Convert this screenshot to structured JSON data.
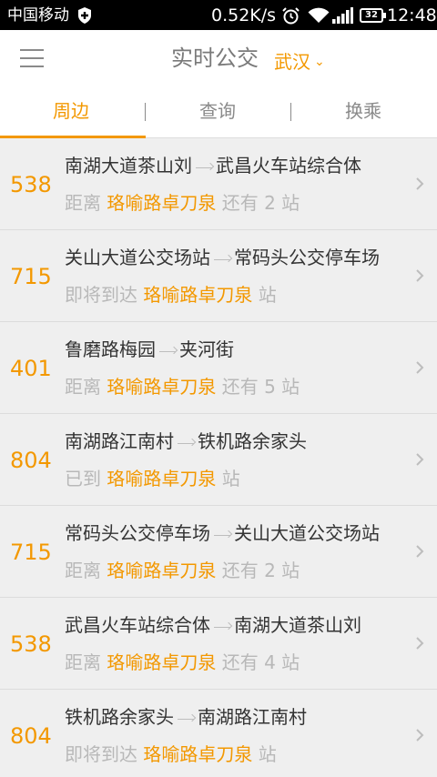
{
  "status_bar": {
    "carrier": "中国移动",
    "net_speed": "0.52K/s",
    "battery": "32",
    "time": "12:48"
  },
  "header": {
    "title": "实时公交",
    "city": "武汉"
  },
  "tabs": [
    {
      "label": "周边",
      "active": true
    },
    {
      "label": "查询",
      "active": false
    },
    {
      "label": "换乘",
      "active": false
    }
  ],
  "colors": {
    "accent": "#f39800",
    "text": "#333333",
    "muted": "#b8b8b8",
    "background": "#efefef"
  },
  "routes": [
    {
      "number": "538",
      "from": "南湖大道茶山刘",
      "to": "武昌火车站综合体",
      "prefix": "距离",
      "stop": "珞喻路卓刀泉",
      "middle": "还有",
      "count": "2",
      "suffix": "站"
    },
    {
      "number": "715",
      "from": "关山大道公交场站",
      "to": "常码头公交停车场",
      "prefix": "即将到达",
      "stop": "珞喻路卓刀泉",
      "middle": "",
      "count": "",
      "suffix": "站"
    },
    {
      "number": "401",
      "from": "鲁磨路梅园",
      "to": "夹河街",
      "prefix": "距离",
      "stop": "珞喻路卓刀泉",
      "middle": "还有",
      "count": "5",
      "suffix": "站"
    },
    {
      "number": "804",
      "from": "南湖路江南村",
      "to": "铁机路余家头",
      "prefix": "已到",
      "stop": "珞喻路卓刀泉",
      "middle": "",
      "count": "",
      "suffix": "站"
    },
    {
      "number": "715",
      "from": "常码头公交停车场",
      "to": "关山大道公交场站",
      "prefix": "距离",
      "stop": "珞喻路卓刀泉",
      "middle": "还有",
      "count": "2",
      "suffix": "站"
    },
    {
      "number": "538",
      "from": "武昌火车站综合体",
      "to": "南湖大道茶山刘",
      "prefix": "距离",
      "stop": "珞喻路卓刀泉",
      "middle": "还有",
      "count": "4",
      "suffix": "站"
    },
    {
      "number": "804",
      "from": "铁机路余家头",
      "to": "南湖路江南村",
      "prefix": "即将到达",
      "stop": "珞喻路卓刀泉",
      "middle": "",
      "count": "",
      "suffix": "站"
    }
  ]
}
